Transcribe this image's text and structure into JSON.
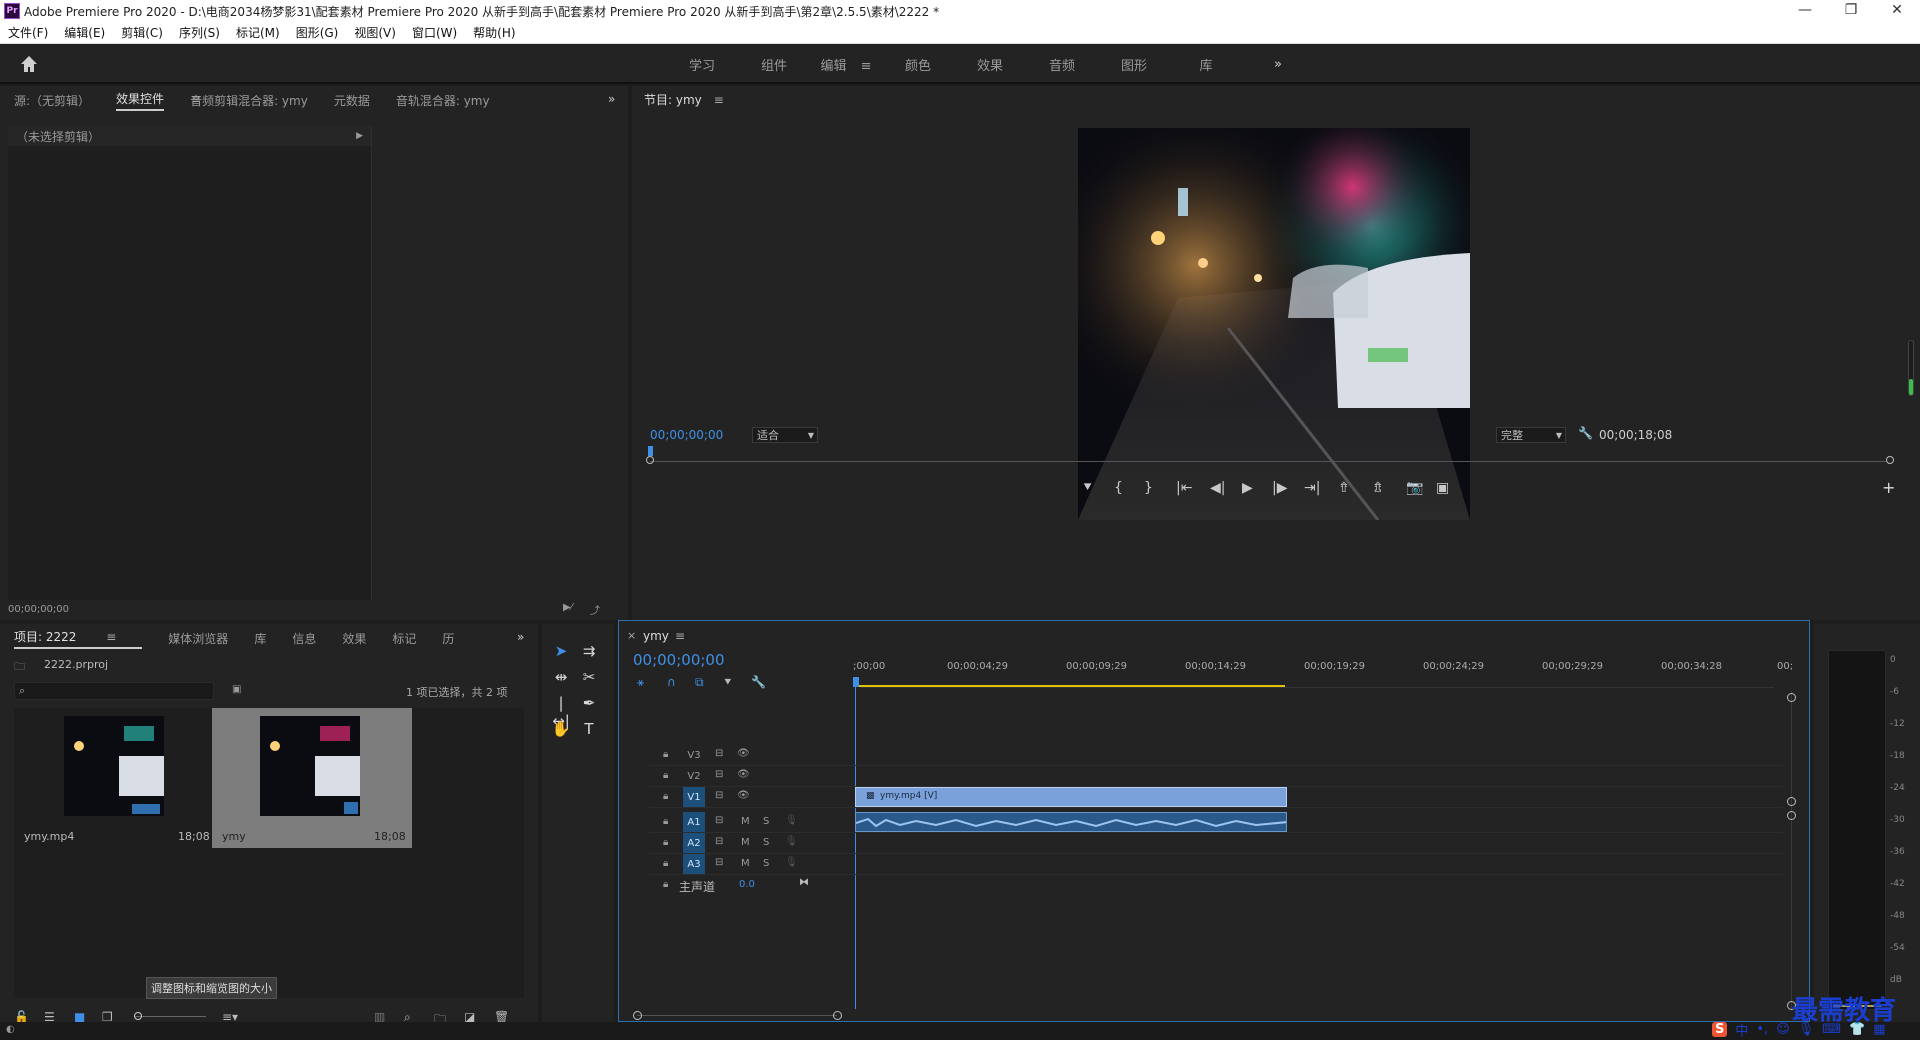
{
  "window": {
    "title": "Adobe Premiere Pro 2020 - D:\\电商2034杨梦影31\\配套素材 Premiere Pro 2020 从新手到高手\\配套素材 Premiere Pro 2020 从新手到高手\\第2章\\2.5.5\\素材\\2222 *",
    "logo_text": "Pr",
    "controls": [
      "—",
      "❐",
      "✕"
    ]
  },
  "menu": [
    "文件(F)",
    "编辑(E)",
    "剪辑(C)",
    "序列(S)",
    "标记(M)",
    "图形(G)",
    "视图(V)",
    "窗口(W)",
    "帮助(H)"
  ],
  "workspaces": {
    "tabs": [
      "学习",
      "组件",
      "编辑",
      "颜色",
      "效果",
      "音频",
      "图形",
      "库"
    ],
    "active": "编辑",
    "more": "»"
  },
  "source_panel": {
    "tabs": [
      "源:（无剪辑）",
      "效果控件",
      "音频剪辑混合器: ymy",
      "元数据",
      "音轨混合器: ymy"
    ],
    "active_tab": "效果控件",
    "no_clip_label": "（未选择剪辑）",
    "timecode": "00;00;00;00",
    "more": "»"
  },
  "program_monitor": {
    "title": "节目: ymy",
    "timecode_left": "00;00;00;00",
    "fit_select": "适合",
    "quality_select": "完整",
    "timecode_right": "00;00;18;08",
    "plus": "+"
  },
  "project_panel": {
    "tabs": [
      "项目: 2222",
      "媒体浏览器",
      "库",
      "信息",
      "效果",
      "标记",
      "历"
    ],
    "active_tab": "项目: 2222",
    "project_file": "2222.prproj",
    "selection_info": "1 项已选择，共 2 项",
    "items": [
      {
        "name": "ymy.mp4",
        "duration": "18;08",
        "selected": false
      },
      {
        "name": "ymy",
        "duration": "18;08",
        "selected": true
      }
    ],
    "tooltip": "调整图标和缩览图的大小",
    "more": "»"
  },
  "timeline": {
    "sequence_name": "ymy",
    "close": "×",
    "timecode": "00;00;00;00",
    "ruler": ";00;00",
    "ruler_ticks": [
      "00;00;04;29",
      "00;00;09;29",
      "00;00;14;29",
      "00;00;19;29",
      "00;00;24;29",
      "00;00;29;29",
      "00;00;34;28",
      "00;"
    ],
    "video_tracks": [
      "V3",
      "V2",
      "V1"
    ],
    "audio_tracks": [
      "A1",
      "A2",
      "A3"
    ],
    "master_label": "主声道",
    "master_value": "0.0",
    "video_clip_label": "ymy.mp4 [V]",
    "mute_label": "M",
    "solo_label": "S"
  },
  "audio_meter": {
    "scale": [
      "0",
      "-6",
      "-12",
      "-18",
      "-24",
      "-30",
      "-36",
      "-42",
      "-48",
      "-54",
      "dB"
    ]
  },
  "watermark": "最需教育",
  "taskbar_ime": "中"
}
